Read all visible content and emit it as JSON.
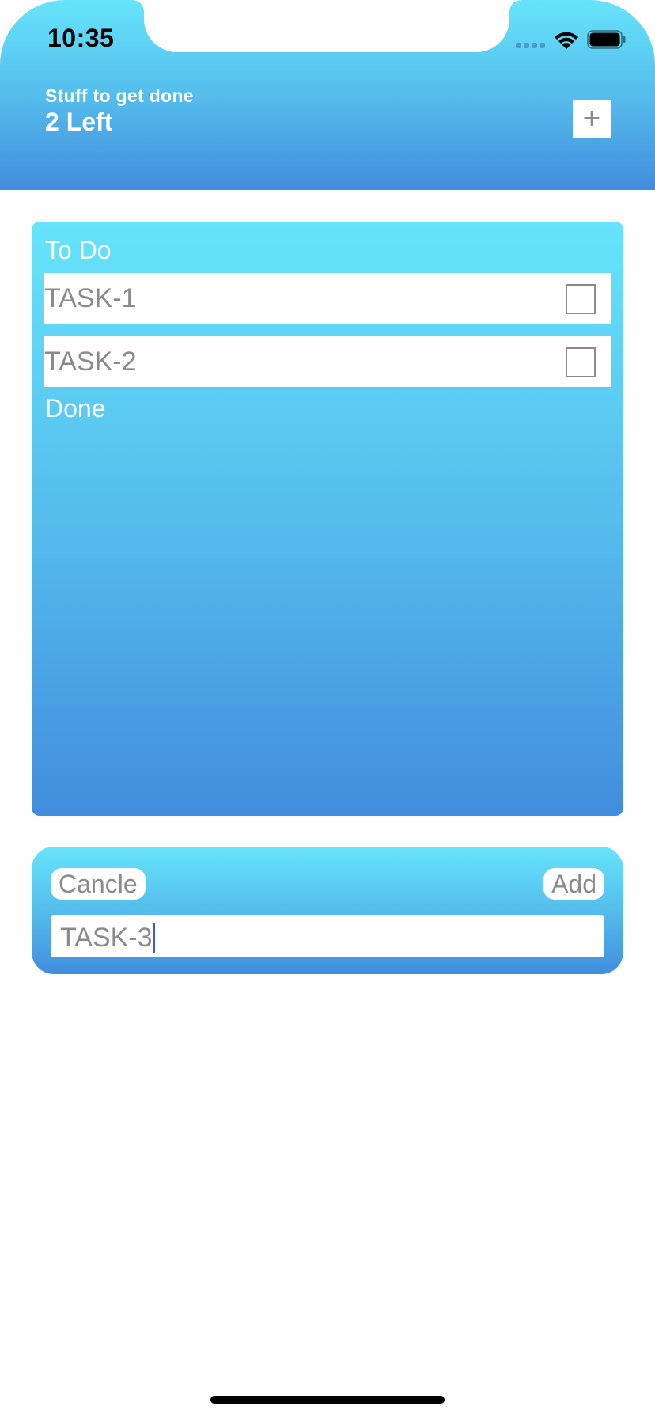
{
  "status_bar": {
    "time": "10:35",
    "icons": [
      "signal-icon",
      "wifi-icon",
      "battery-icon"
    ]
  },
  "header": {
    "subtitle": "Stuff to get done",
    "title": "2 Left",
    "add_button_label": "+"
  },
  "task_list": {
    "todo_heading": "To Do",
    "todo_items": [
      {
        "label": "TASK-1",
        "checked": false
      },
      {
        "label": "TASK-2",
        "checked": false
      }
    ],
    "done_heading": "Done",
    "done_items": []
  },
  "add_panel": {
    "cancel_label": "Cancle",
    "add_label": "Add",
    "input_value": "TASK-3"
  },
  "colors": {
    "gradient_top": "#66e4fb",
    "gradient_bottom": "#428ddd",
    "text_muted": "#8a8a8a"
  }
}
